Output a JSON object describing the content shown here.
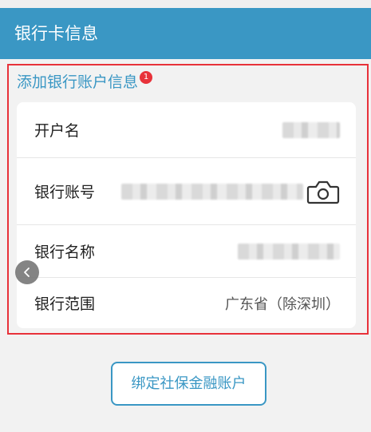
{
  "header": {
    "title": "银行卡信息"
  },
  "section": {
    "title": "添加银行账户信息",
    "badge": "1",
    "rows": [
      {
        "label": "开户名"
      },
      {
        "label": "银行账号",
        "icon": "camera-icon"
      },
      {
        "label": "银行名称"
      },
      {
        "label": "银行范围",
        "value": "广东省（除深圳）"
      }
    ]
  },
  "actions": {
    "bind_label": "绑定社保金融账户"
  },
  "colors": {
    "accent": "#3a97c4",
    "highlight_border": "#e8323a"
  }
}
